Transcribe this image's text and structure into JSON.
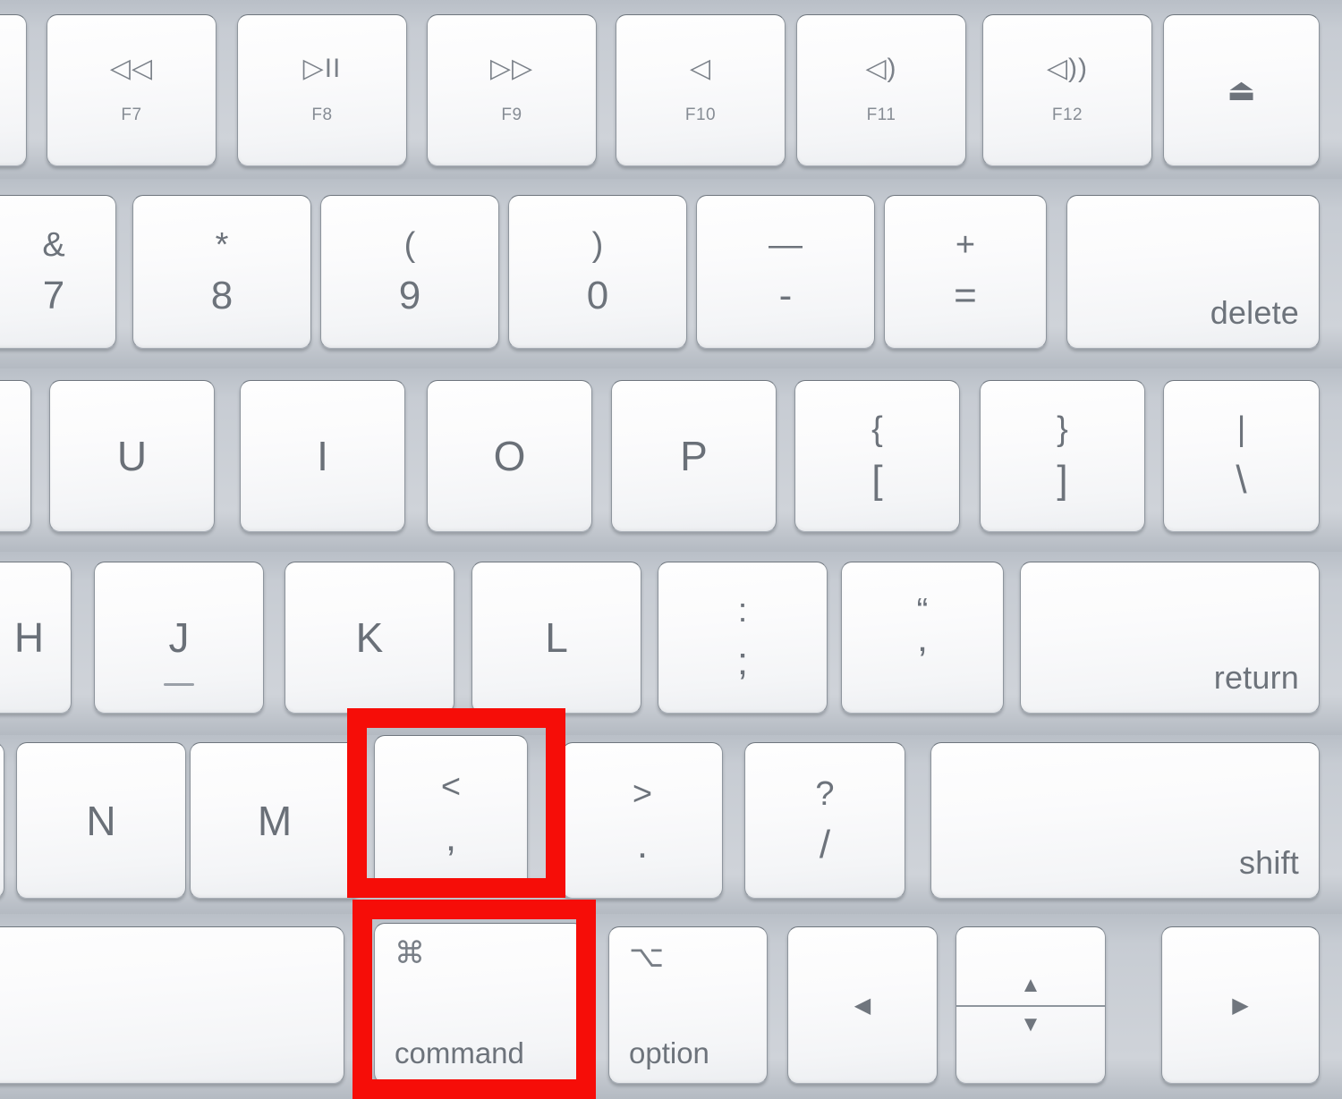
{
  "device": {
    "name": "apple-magic-keyboard",
    "description": "Close-up photo of the right portion of an Apple Magic Keyboard",
    "chassis_color": "#c5c9cf",
    "key_face_color": "#f7f8fa",
    "legend_color": "#6d737b"
  },
  "highlight": {
    "color": "#f60d08",
    "border_width_px": 22,
    "targets": [
      "comma-key",
      "command-key"
    ],
    "shortcut_implied": "command + comma"
  },
  "rows": [
    {
      "id": "function-row",
      "keys": [
        {
          "id": "f6-partial",
          "type": "function",
          "icon": "",
          "label": "",
          "partial": true
        },
        {
          "id": "f7-key",
          "type": "function",
          "icon": "rewind-icon",
          "glyph": "◁◁",
          "label": "F7"
        },
        {
          "id": "f8-key",
          "type": "function",
          "icon": "play-pause-icon",
          "glyph": "▷II",
          "label": "F8"
        },
        {
          "id": "f9-key",
          "type": "function",
          "icon": "fast-forward-icon",
          "glyph": "▷▷",
          "label": "F9"
        },
        {
          "id": "f10-key",
          "type": "function",
          "icon": "mute-icon",
          "glyph": "◁",
          "label": "F10"
        },
        {
          "id": "f11-key",
          "type": "function",
          "icon": "volume-down-icon",
          "glyph": "◁)",
          "label": "F11"
        },
        {
          "id": "f12-key",
          "type": "function",
          "icon": "volume-up-icon",
          "glyph": "◁))",
          "label": "F12"
        },
        {
          "id": "eject-key",
          "type": "function",
          "icon": "eject-icon",
          "glyph": "⏏",
          "label": ""
        }
      ]
    },
    {
      "id": "number-row",
      "keys": [
        {
          "id": "7-key",
          "type": "dual",
          "upper": "&",
          "lower": "7",
          "partial": true
        },
        {
          "id": "8-key",
          "type": "dual",
          "upper": "*",
          "lower": "8"
        },
        {
          "id": "9-key",
          "type": "dual",
          "upper": "(",
          "lower": "9"
        },
        {
          "id": "0-key",
          "type": "dual",
          "upper": ")",
          "lower": "0"
        },
        {
          "id": "minus-key",
          "type": "dual",
          "upper": "—",
          "lower": "-"
        },
        {
          "id": "equals-key",
          "type": "dual",
          "upper": "+",
          "lower": "="
        },
        {
          "id": "delete-key",
          "type": "word",
          "label": "delete"
        }
      ]
    },
    {
      "id": "top-letter-row",
      "keys": [
        {
          "id": "y-key",
          "type": "letter",
          "label": "",
          "partial": true
        },
        {
          "id": "u-key",
          "type": "letter",
          "label": "U"
        },
        {
          "id": "i-key",
          "type": "letter",
          "label": "I"
        },
        {
          "id": "o-key",
          "type": "letter",
          "label": "O"
        },
        {
          "id": "p-key",
          "type": "letter",
          "label": "P"
        },
        {
          "id": "left-bracket-key",
          "type": "dual",
          "upper": "{",
          "lower": "["
        },
        {
          "id": "right-bracket-key",
          "type": "dual",
          "upper": "}",
          "lower": "]"
        },
        {
          "id": "backslash-key",
          "type": "dual",
          "upper": "|",
          "lower": "\\"
        }
      ]
    },
    {
      "id": "home-row",
      "keys": [
        {
          "id": "h-key",
          "type": "letter",
          "label": "H",
          "partial": true
        },
        {
          "id": "j-key",
          "type": "letter",
          "label": "J",
          "homing": true
        },
        {
          "id": "k-key",
          "type": "letter",
          "label": "K"
        },
        {
          "id": "l-key",
          "type": "letter",
          "label": "L"
        },
        {
          "id": "semicolon-key",
          "type": "dual",
          "upper": ":",
          "lower": ";"
        },
        {
          "id": "quote-key",
          "type": "dual",
          "upper": "“",
          "lower": "’"
        },
        {
          "id": "return-key",
          "type": "word",
          "label": "return"
        }
      ]
    },
    {
      "id": "bottom-letter-row",
      "keys": [
        {
          "id": "b-key",
          "type": "letter",
          "label": "",
          "partial": true
        },
        {
          "id": "n-key",
          "type": "letter",
          "label": "N"
        },
        {
          "id": "m-key",
          "type": "letter",
          "label": "M"
        },
        {
          "id": "comma-key",
          "type": "dual",
          "upper": "<",
          "lower": ",",
          "highlighted": true
        },
        {
          "id": "period-key",
          "type": "dual",
          "upper": ">",
          "lower": "."
        },
        {
          "id": "slash-key",
          "type": "dual",
          "upper": "?",
          "lower": "/"
        },
        {
          "id": "shift-key",
          "type": "word",
          "label": "shift"
        }
      ]
    },
    {
      "id": "modifier-row",
      "keys": [
        {
          "id": "space-key",
          "type": "blank",
          "label": ""
        },
        {
          "id": "command-key",
          "type": "modifier",
          "symbol": "⌘",
          "label": "command",
          "highlighted": true
        },
        {
          "id": "option-key",
          "type": "modifier",
          "symbol": "⌥",
          "label": "option"
        },
        {
          "id": "left-arrow-key",
          "type": "arrow",
          "glyph": "◀",
          "label": "left-arrow-icon"
        },
        {
          "id": "up-down-arrow-key",
          "type": "arrow-split",
          "upper_glyph": "▲",
          "lower_glyph": "▼",
          "label": "up-down-arrow-icon"
        },
        {
          "id": "right-arrow-key",
          "type": "arrow",
          "glyph": "▶",
          "label": "right-arrow-icon"
        }
      ]
    }
  ]
}
